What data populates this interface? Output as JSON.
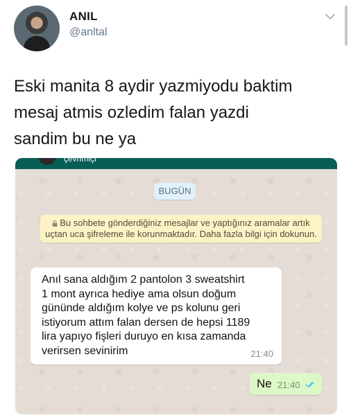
{
  "tweet": {
    "display_name": "ANIL",
    "handle": "@anltal",
    "text_lines": [
      "Eski manita 8 aydir yazmiyodu baktim",
      "mesaj atmis ozledim falan yazdi",
      "sandim bu ne ya"
    ]
  },
  "chat": {
    "header_status": "çevrimiçi",
    "date_chip": "BUGÜN",
    "encryption_notice": "Bu sohbete gönderdiğiniz mesajlar ve yaptığınız aramalar artık uçtan uca şifreleme ile korunmaktadır. Daha fazla bilgi için dokunun.",
    "incoming": {
      "lines": [
        "Anıl sana aldığım 2 pantolon 3 sweatshirt",
        "1 mont ayrıca hediye ama olsun doğum",
        "gününde aldığım kolye ve ps kolunu geri",
        "istiyorum attım falan dersen de hepsi 1189",
        "lira yapıyo fişleri duruyo en kısa zamanda",
        "verirsen sevinirim"
      ],
      "time": "21:40"
    },
    "outgoing": {
      "text": "Ne",
      "time": "21:40"
    }
  },
  "colors": {
    "header": "#075e54",
    "chat_bg": "#e5ddd5",
    "outgoing_bubble": "#dcf8c6",
    "notice_bg": "#fdf4c5",
    "read_ticks": "#4fc3f7"
  },
  "icons": [
    "chevron-down-icon",
    "lock-icon",
    "double-check-icon"
  ]
}
